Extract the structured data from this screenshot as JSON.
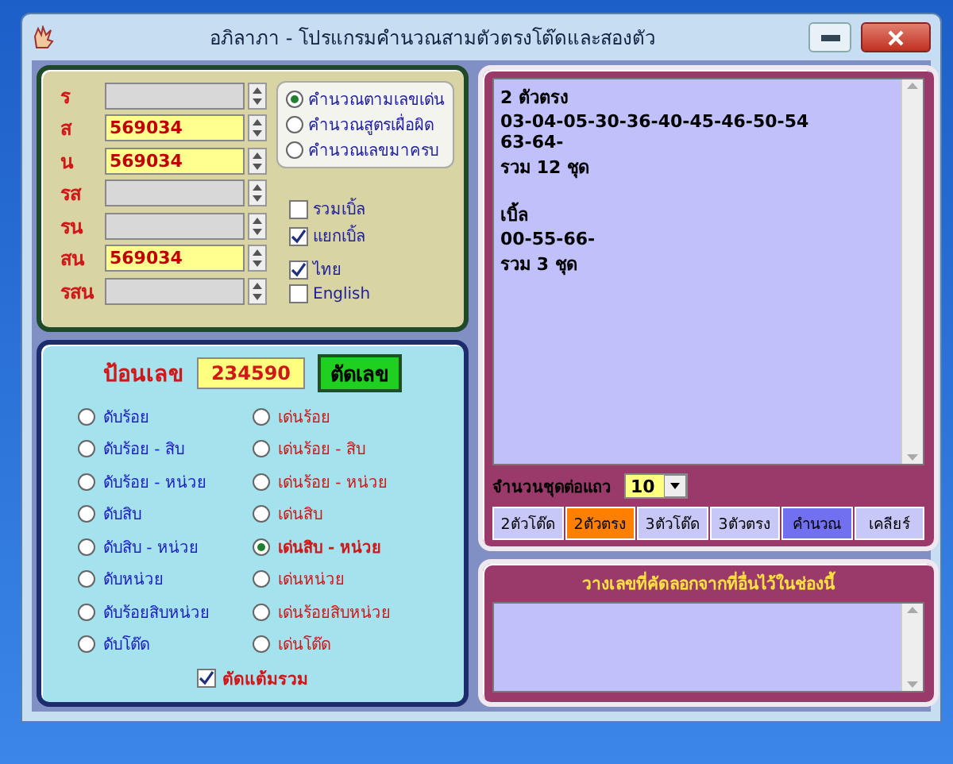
{
  "window": {
    "title": "อภิลาภา - โปรแกรมคำนวณสามตัวตรงโต๊ดและสองตัว"
  },
  "fields": [
    {
      "label": "ร"
    },
    {
      "label": "ส",
      "value": "569034"
    },
    {
      "label": "น",
      "value": "569034"
    },
    {
      "label": "รส"
    },
    {
      "label": "รน"
    },
    {
      "label": "สน",
      "value": "569034"
    },
    {
      "label": "รสน"
    }
  ],
  "calc_modes": [
    {
      "label": "คำนวณตามเลขเด่น",
      "selected": true
    },
    {
      "label": "คำนวณสูตรเผื่อผิด",
      "selected": false
    },
    {
      "label": "คำนวณเลขมาครบ",
      "selected": false
    }
  ],
  "option_groups": [
    [
      {
        "label": "รวมเบิ้ล",
        "checked": false
      },
      {
        "label": "แยกเบิ้ล",
        "checked": true
      }
    ],
    [
      {
        "label": "ไทย",
        "checked": true
      },
      {
        "label": "English",
        "checked": false
      }
    ]
  ],
  "entry": {
    "label": "ป้อนเลข",
    "value": "234590",
    "button": "ตัดเลข"
  },
  "cut_columns": [
    [
      {
        "label": "ดับร้อย",
        "selected": false
      },
      {
        "label": "ดับร้อย - สิบ",
        "selected": false
      },
      {
        "label": "ดับร้อย - หน่วย",
        "selected": false
      },
      {
        "label": "ดับสิบ",
        "selected": false
      },
      {
        "label": "ดับสิบ - หน่วย",
        "selected": false
      },
      {
        "label": "ดับหน่วย",
        "selected": false
      },
      {
        "label": "ดับร้อยสิบหน่วย",
        "selected": false
      },
      {
        "label": "ดับโต๊ด",
        "selected": false
      }
    ],
    [
      {
        "label": "เด่นร้อย",
        "selected": false
      },
      {
        "label": "เด่นร้อย - สิบ",
        "selected": false
      },
      {
        "label": "เด่นร้อย - หน่วย",
        "selected": false
      },
      {
        "label": "เด่นสิบ",
        "selected": false
      },
      {
        "label": "เด่นสิบ - หน่วย",
        "selected": true
      },
      {
        "label": "เด่นหน่วย",
        "selected": false
      },
      {
        "label": "เด่นร้อยสิบหน่วย",
        "selected": false
      },
      {
        "label": "เด่นโต๊ด",
        "selected": false
      }
    ]
  ],
  "sum_cut": {
    "label": "ตัดแต้มรวม",
    "checked": true
  },
  "result_blocks": [
    [
      "2 ตัวตรง",
      "03-04-05-30-36-40-45-46-50-54",
      "63-64-",
      "รวม 12 ชุด"
    ],
    [
      "เบิ้ล",
      "00-55-66-",
      "รวม 3 ชุด"
    ]
  ],
  "per_row": {
    "label": "จำนวนชุดต่อแถว",
    "value": "10"
  },
  "buttons": [
    {
      "label": "2ตัวโต๊ด",
      "kind": "tab",
      "selected": false
    },
    {
      "label": "2ตัวตรง",
      "kind": "tab",
      "selected": true
    },
    {
      "label": "3ตัวโต๊ด",
      "kind": "tab",
      "selected": false
    },
    {
      "label": "3ตัวตรง",
      "kind": "tab",
      "selected": false
    },
    {
      "label": "คำนวณ",
      "kind": "compute"
    },
    {
      "label": "เคลียร์",
      "kind": "clear"
    }
  ],
  "paste_panel": {
    "title": "วางเลขที่คัดลอกจากที่อื่นไว้ในช่องนี้"
  }
}
